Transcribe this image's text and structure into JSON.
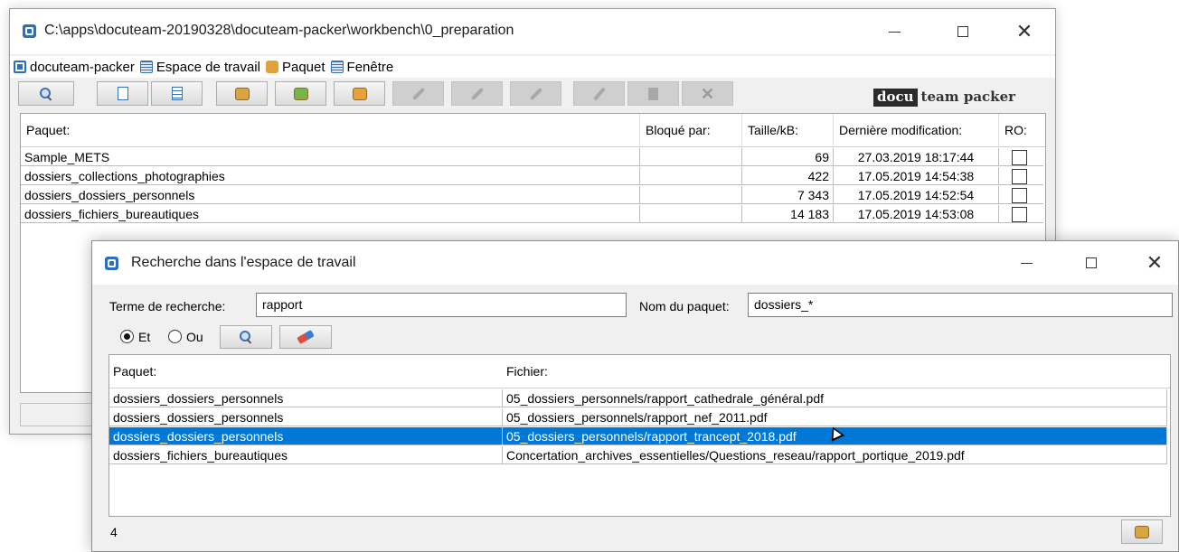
{
  "main_window": {
    "title": "C:\\apps\\docuteam-20190328\\docuteam-packer\\workbench\\0_preparation",
    "menu": [
      "docuteam-packer",
      "Espace de travail",
      "Paquet",
      "Fenêtre"
    ],
    "logo": {
      "part1": "docu",
      "part2": "team packer"
    },
    "table": {
      "headers": [
        "Paquet:",
        "Bloqué par:",
        "Taille/kB:",
        "Dernière modification:",
        "RO:"
      ],
      "rows": [
        {
          "name": "Sample_METS",
          "locked": "",
          "size": "69",
          "modified": "27.03.2019 18:17:44"
        },
        {
          "name": "dossiers_collections_photographies",
          "locked": "",
          "size": "422",
          "modified": "17.05.2019 14:54:38"
        },
        {
          "name": "dossiers_dossiers_personnels",
          "locked": "",
          "size": "7 343",
          "modified": "17.05.2019 14:52:54"
        },
        {
          "name": "dossiers_fichiers_bureautiques",
          "locked": "",
          "size": "14 183",
          "modified": "17.05.2019 14:53:08"
        }
      ]
    }
  },
  "search_dialog": {
    "title": "Recherche dans l'espace de travail",
    "search_term_label": "Terme de recherche:",
    "search_term_value": "rapport",
    "package_name_label": "Nom du paquet:",
    "package_name_value": "dossiers_*",
    "radio_and": "Et",
    "radio_or": "Ou",
    "table": {
      "headers": [
        "Paquet:",
        "Fichier:"
      ],
      "rows": [
        {
          "package": "dossiers_dossiers_personnels",
          "file": "05_dossiers_personnels/rapport_cathedrale_général.pdf"
        },
        {
          "package": "dossiers_dossiers_personnels",
          "file": "05_dossiers_personnels/rapport_nef_2011.pdf"
        },
        {
          "package": "dossiers_dossiers_personnels",
          "file": "05_dossiers_personnels/rapport_trancept_2018.pdf"
        },
        {
          "package": "dossiers_fichiers_bureautiques",
          "file": "Concertation_archives_essentielles/Questions_reseau/rapport_portique_2019.pdf"
        }
      ]
    },
    "result_count": "4"
  },
  "colors": {
    "selection": "#0078d7",
    "accent": "#2a6fc0"
  }
}
